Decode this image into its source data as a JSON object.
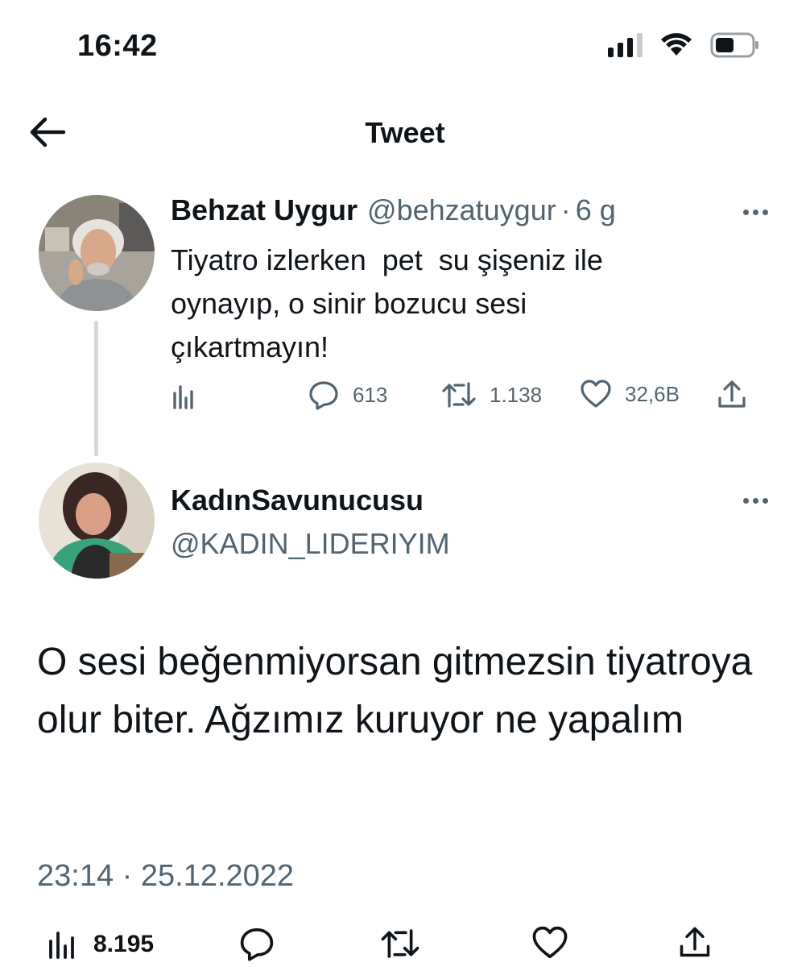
{
  "status_bar": {
    "time": "16:42"
  },
  "header": {
    "title": "Tweet"
  },
  "parent_tweet": {
    "author_name": "Behzat Uygur",
    "handle": "@behzatuygur",
    "separator": "·",
    "age": "6 g",
    "text": "Tiyatro izlerken  pet  su şişeniz ile\noynayıp, o sinir bozucu sesi\nçıkartmayın!",
    "replies": "613",
    "retweets": "1.138",
    "likes": "32,6B"
  },
  "reply_tweet": {
    "author_name": "KadınSavunucusu",
    "handle": "@KADIN_LIDERIYIM",
    "text": "O sesi beğenmiyorsan gitmezsin tiyatroya olur biter. Ağzımız kuruyor ne yapalım",
    "timestamp": "23:14 · 25.12.2022",
    "views": "8.195"
  },
  "colors": {
    "text_primary": "#0f1419",
    "text_secondary": "#536471",
    "thread_line": "#cfd9de"
  }
}
